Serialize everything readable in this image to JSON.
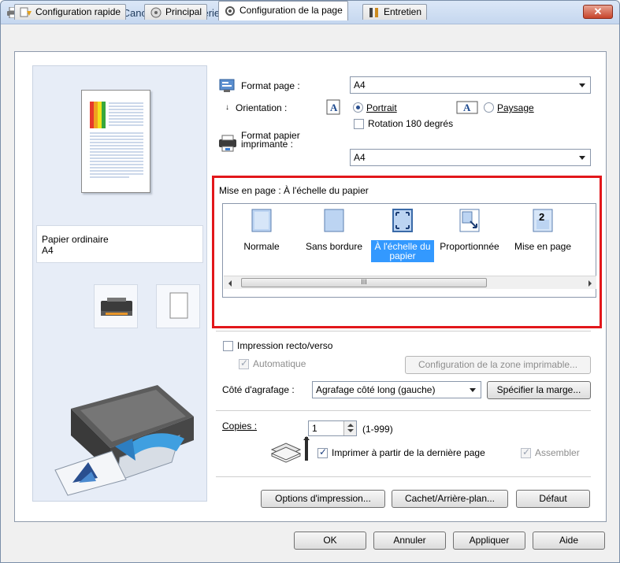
{
  "window": {
    "title": "Options d'impression Canon MG5400 series Printer",
    "close_label": "✕"
  },
  "tabs": [
    {
      "label": "Configuration rapide",
      "icon": "quick-setup-icon"
    },
    {
      "label": "Principal",
      "icon": "main-icon"
    },
    {
      "label": "Configuration de la page",
      "icon": "page-setup-icon",
      "active": true
    },
    {
      "label": "Entretien",
      "icon": "maintenance-icon"
    }
  ],
  "preview": {
    "media_type": "Papier ordinaire",
    "paper_size": "A4"
  },
  "page_setup": {
    "page_size_label": "Format page :",
    "page_size_value": "A4",
    "orientation_label": "Orientation :",
    "portrait_label": "Portrait",
    "landscape_label": "Paysage",
    "orientation_selected": "Portrait",
    "rotate_label": "Rotation 180 degrés",
    "rotate_checked": false,
    "printer_paper_size_label_line1": "Format papier",
    "printer_paper_size_label_line2": "imprimante :",
    "printer_paper_size_value": "A4"
  },
  "layout": {
    "heading": "Mise en page : À l'échelle du papier",
    "items": [
      {
        "label": "Normale",
        "icon": "normal-size-icon"
      },
      {
        "label": "Sans bordure",
        "icon": "borderless-icon"
      },
      {
        "label": "À l'échelle du papier",
        "icon": "fit-to-page-icon",
        "selected": true
      },
      {
        "label": "Proportionnée",
        "icon": "scaled-icon"
      },
      {
        "label": "Mise en page",
        "icon": "page-layout-icon",
        "badge": "2"
      }
    ],
    "scroll_grip": "III"
  },
  "duplex": {
    "label": "Impression recto/verso",
    "checked": false,
    "auto_label": "Automatique",
    "auto_checked": true,
    "print_area_button": "Configuration de la zone imprimable..."
  },
  "stapling": {
    "label": "Côté d'agrafage :",
    "value": "Agrafage côté long (gauche)",
    "margin_button": "Spécifier la marge..."
  },
  "copies": {
    "label": "Copies :",
    "value": "1",
    "range": "(1-999)",
    "last_page_label": "Imprimer à partir de la dernière page",
    "last_page_checked": true,
    "collate_label": "Assembler",
    "collate_checked": true
  },
  "buttons": {
    "print_options": "Options d'impression...",
    "stamp_background": "Cachet/Arrière-plan...",
    "defaults": "Défaut",
    "ok": "OK",
    "cancel": "Annuler",
    "apply": "Appliquer",
    "help": "Aide"
  },
  "colors": {
    "highlight_border": "#e2171b",
    "selection": "#3399ff"
  }
}
